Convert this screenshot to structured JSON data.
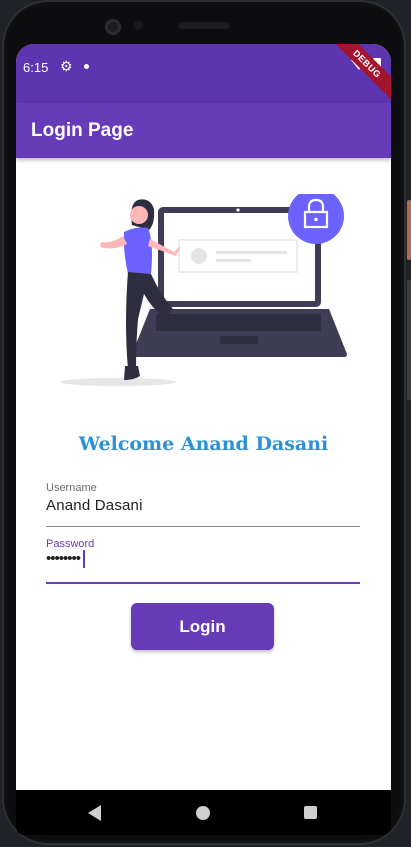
{
  "status_bar": {
    "time": "6:15",
    "debug_label": "DEBUG"
  },
  "app_bar": {
    "title": "Login Page"
  },
  "welcome_text": "Welcome Anand Dasani",
  "username": {
    "label": "Username",
    "value": "Anand Dasani"
  },
  "password": {
    "label": "Password",
    "masked_value": "••••••••"
  },
  "login_button": {
    "label": "Login"
  },
  "icons": {
    "settings": "gear-icon",
    "wifi": "wifi-icon",
    "battery": "battery-icon",
    "lock": "lock-icon",
    "back": "back-icon",
    "home": "home-icon",
    "recents": "recents-icon"
  },
  "colors": {
    "status_bar": "#5e35b1",
    "app_bar": "#673ab7",
    "accent": "#673ab7",
    "welcome_text": "#2e90d6",
    "illustration_accent": "#6c63ff"
  }
}
